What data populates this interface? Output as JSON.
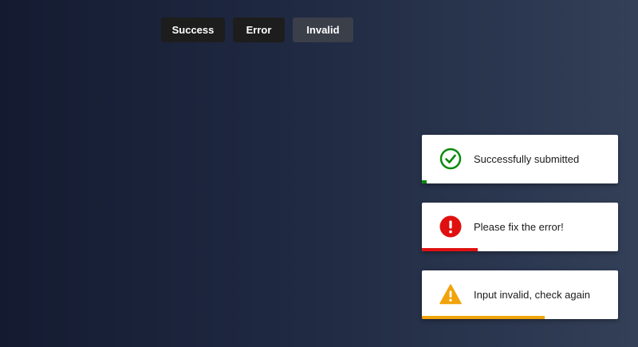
{
  "buttons": {
    "success_label": "Success",
    "error_label": "Error",
    "invalid_label": "Invalid"
  },
  "toasts": [
    {
      "kind": "success",
      "message": "Successfully submitted",
      "icon": "check-circle-icon",
      "color": "#0a8a0a",
      "progress": 0.025
    },
    {
      "kind": "error",
      "message": "Please fix the error!",
      "icon": "exclamation-circle-icon",
      "color": "#e01010",
      "progress": 0.285
    },
    {
      "kind": "invalid",
      "message": "Input invalid, check again",
      "icon": "warning-triangle-icon",
      "color": "#f0a30a",
      "progress": 0.625
    }
  ]
}
